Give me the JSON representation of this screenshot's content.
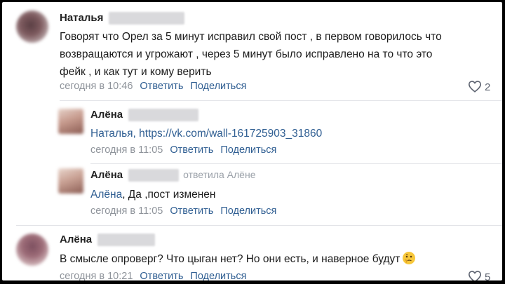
{
  "comments": [
    {
      "author": "Наталья",
      "lines": [
        "Говорят что Орел за 5 минут исправил свой пост , в первом говорилось что",
        "возвращаются и угрожают , через 5 минут было исправлено на то что это",
        "фейк , и как тут и кому верить"
      ],
      "time": "сегодня в 10:46",
      "reply_label": "Ответить",
      "share_label": "Поделиться",
      "likes": "2"
    },
    {
      "author": "Алёна",
      "mention": "Наталья",
      "text": ", https://vk.com/wall-161725903_31860",
      "time": "сегодня в 11:05",
      "reply_label": "Ответить",
      "share_label": "Поделиться"
    },
    {
      "author": "Алёна",
      "reply_to": "ответила Алёне",
      "mention": "Алёна",
      "text": ", Да ,пост изменен",
      "time": "сегодня в 11:05",
      "reply_label": "Ответить",
      "share_label": "Поделиться"
    },
    {
      "author": "Алёна",
      "text": "В смысле опроверг? Что цыган нет? Но они есть, и наверное будут",
      "time": "сегодня в 10:21",
      "reply_label": "Ответить",
      "share_label": "Поделиться",
      "likes": "5"
    }
  ],
  "icons": {
    "like": "heart-outline-icon",
    "emoji": "thinking-face-icon"
  },
  "colors": {
    "link": "#2f5e92",
    "meta": "#8e939a",
    "text": "#1b1b1b"
  }
}
